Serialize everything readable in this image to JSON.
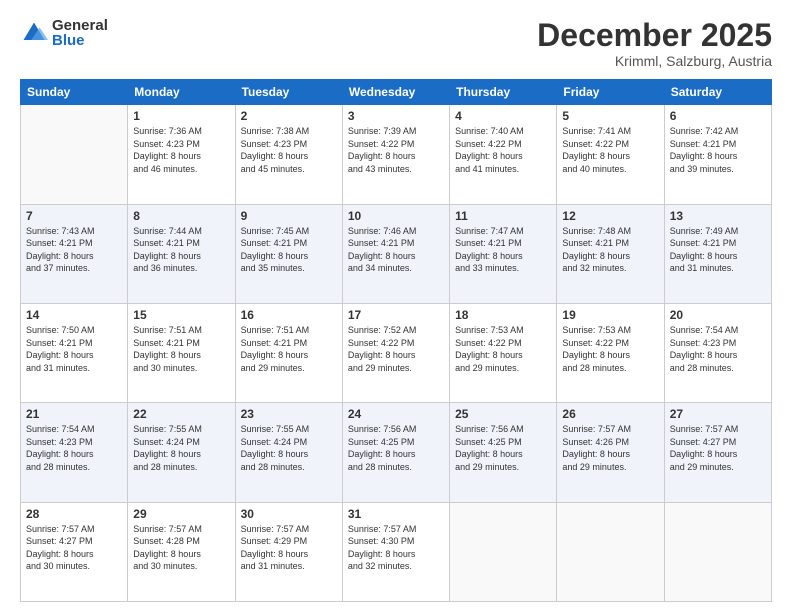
{
  "logo": {
    "general": "General",
    "blue": "Blue"
  },
  "header": {
    "month": "December 2025",
    "location": "Krimml, Salzburg, Austria"
  },
  "weekdays": [
    "Sunday",
    "Monday",
    "Tuesday",
    "Wednesday",
    "Thursday",
    "Friday",
    "Saturday"
  ],
  "weeks": [
    [
      {
        "day": "",
        "info": ""
      },
      {
        "day": "1",
        "info": "Sunrise: 7:36 AM\nSunset: 4:23 PM\nDaylight: 8 hours\nand 46 minutes."
      },
      {
        "day": "2",
        "info": "Sunrise: 7:38 AM\nSunset: 4:23 PM\nDaylight: 8 hours\nand 45 minutes."
      },
      {
        "day": "3",
        "info": "Sunrise: 7:39 AM\nSunset: 4:22 PM\nDaylight: 8 hours\nand 43 minutes."
      },
      {
        "day": "4",
        "info": "Sunrise: 7:40 AM\nSunset: 4:22 PM\nDaylight: 8 hours\nand 41 minutes."
      },
      {
        "day": "5",
        "info": "Sunrise: 7:41 AM\nSunset: 4:22 PM\nDaylight: 8 hours\nand 40 minutes."
      },
      {
        "day": "6",
        "info": "Sunrise: 7:42 AM\nSunset: 4:21 PM\nDaylight: 8 hours\nand 39 minutes."
      }
    ],
    [
      {
        "day": "7",
        "info": "Sunrise: 7:43 AM\nSunset: 4:21 PM\nDaylight: 8 hours\nand 37 minutes."
      },
      {
        "day": "8",
        "info": "Sunrise: 7:44 AM\nSunset: 4:21 PM\nDaylight: 8 hours\nand 36 minutes."
      },
      {
        "day": "9",
        "info": "Sunrise: 7:45 AM\nSunset: 4:21 PM\nDaylight: 8 hours\nand 35 minutes."
      },
      {
        "day": "10",
        "info": "Sunrise: 7:46 AM\nSunset: 4:21 PM\nDaylight: 8 hours\nand 34 minutes."
      },
      {
        "day": "11",
        "info": "Sunrise: 7:47 AM\nSunset: 4:21 PM\nDaylight: 8 hours\nand 33 minutes."
      },
      {
        "day": "12",
        "info": "Sunrise: 7:48 AM\nSunset: 4:21 PM\nDaylight: 8 hours\nand 32 minutes."
      },
      {
        "day": "13",
        "info": "Sunrise: 7:49 AM\nSunset: 4:21 PM\nDaylight: 8 hours\nand 31 minutes."
      }
    ],
    [
      {
        "day": "14",
        "info": "Sunrise: 7:50 AM\nSunset: 4:21 PM\nDaylight: 8 hours\nand 31 minutes."
      },
      {
        "day": "15",
        "info": "Sunrise: 7:51 AM\nSunset: 4:21 PM\nDaylight: 8 hours\nand 30 minutes."
      },
      {
        "day": "16",
        "info": "Sunrise: 7:51 AM\nSunset: 4:21 PM\nDaylight: 8 hours\nand 29 minutes."
      },
      {
        "day": "17",
        "info": "Sunrise: 7:52 AM\nSunset: 4:22 PM\nDaylight: 8 hours\nand 29 minutes."
      },
      {
        "day": "18",
        "info": "Sunrise: 7:53 AM\nSunset: 4:22 PM\nDaylight: 8 hours\nand 29 minutes."
      },
      {
        "day": "19",
        "info": "Sunrise: 7:53 AM\nSunset: 4:22 PM\nDaylight: 8 hours\nand 28 minutes."
      },
      {
        "day": "20",
        "info": "Sunrise: 7:54 AM\nSunset: 4:23 PM\nDaylight: 8 hours\nand 28 minutes."
      }
    ],
    [
      {
        "day": "21",
        "info": "Sunrise: 7:54 AM\nSunset: 4:23 PM\nDaylight: 8 hours\nand 28 minutes."
      },
      {
        "day": "22",
        "info": "Sunrise: 7:55 AM\nSunset: 4:24 PM\nDaylight: 8 hours\nand 28 minutes."
      },
      {
        "day": "23",
        "info": "Sunrise: 7:55 AM\nSunset: 4:24 PM\nDaylight: 8 hours\nand 28 minutes."
      },
      {
        "day": "24",
        "info": "Sunrise: 7:56 AM\nSunset: 4:25 PM\nDaylight: 8 hours\nand 28 minutes."
      },
      {
        "day": "25",
        "info": "Sunrise: 7:56 AM\nSunset: 4:25 PM\nDaylight: 8 hours\nand 29 minutes."
      },
      {
        "day": "26",
        "info": "Sunrise: 7:57 AM\nSunset: 4:26 PM\nDaylight: 8 hours\nand 29 minutes."
      },
      {
        "day": "27",
        "info": "Sunrise: 7:57 AM\nSunset: 4:27 PM\nDaylight: 8 hours\nand 29 minutes."
      }
    ],
    [
      {
        "day": "28",
        "info": "Sunrise: 7:57 AM\nSunset: 4:27 PM\nDaylight: 8 hours\nand 30 minutes."
      },
      {
        "day": "29",
        "info": "Sunrise: 7:57 AM\nSunset: 4:28 PM\nDaylight: 8 hours\nand 30 minutes."
      },
      {
        "day": "30",
        "info": "Sunrise: 7:57 AM\nSunset: 4:29 PM\nDaylight: 8 hours\nand 31 minutes."
      },
      {
        "day": "31",
        "info": "Sunrise: 7:57 AM\nSunset: 4:30 PM\nDaylight: 8 hours\nand 32 minutes."
      },
      {
        "day": "",
        "info": ""
      },
      {
        "day": "",
        "info": ""
      },
      {
        "day": "",
        "info": ""
      }
    ]
  ]
}
